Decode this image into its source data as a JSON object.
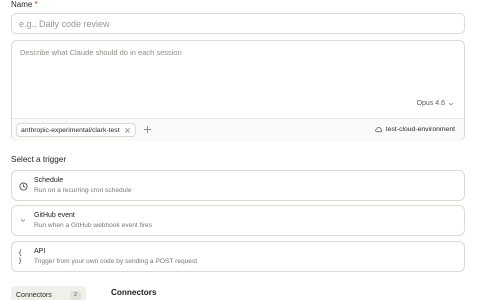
{
  "name_field": {
    "label": "Name",
    "required_marker": "*",
    "placeholder": "e.g., Daily code review",
    "value": ""
  },
  "prompt": {
    "placeholder": "Describe what Claude should do in each session",
    "value": "",
    "model": "Opus 4.6",
    "repo_chip": "anthropic-experimental/clark-test",
    "environment": "test-cloud-environment",
    "icons": [
      "chevron-down-icon",
      "close-icon",
      "plus-icon",
      "cloud-icon"
    ]
  },
  "trigger_section": {
    "title": "Select a trigger",
    "items": [
      {
        "title": "Schedule",
        "description": "Run on a recurring cron schedule",
        "icon": "clock-icon"
      },
      {
        "title": "GitHub event",
        "description": "Run when a GitHub webhook event fires",
        "icon": "git-branch-icon",
        "glyph": "⑂"
      },
      {
        "title": "API",
        "description": "Trigger from your own code by sending a POST request",
        "icon": "code-braces-icon",
        "glyph": "{ }"
      }
    ]
  },
  "connectors": {
    "tab_label": "Connectors",
    "count": "2",
    "heading": "Connectors"
  }
}
